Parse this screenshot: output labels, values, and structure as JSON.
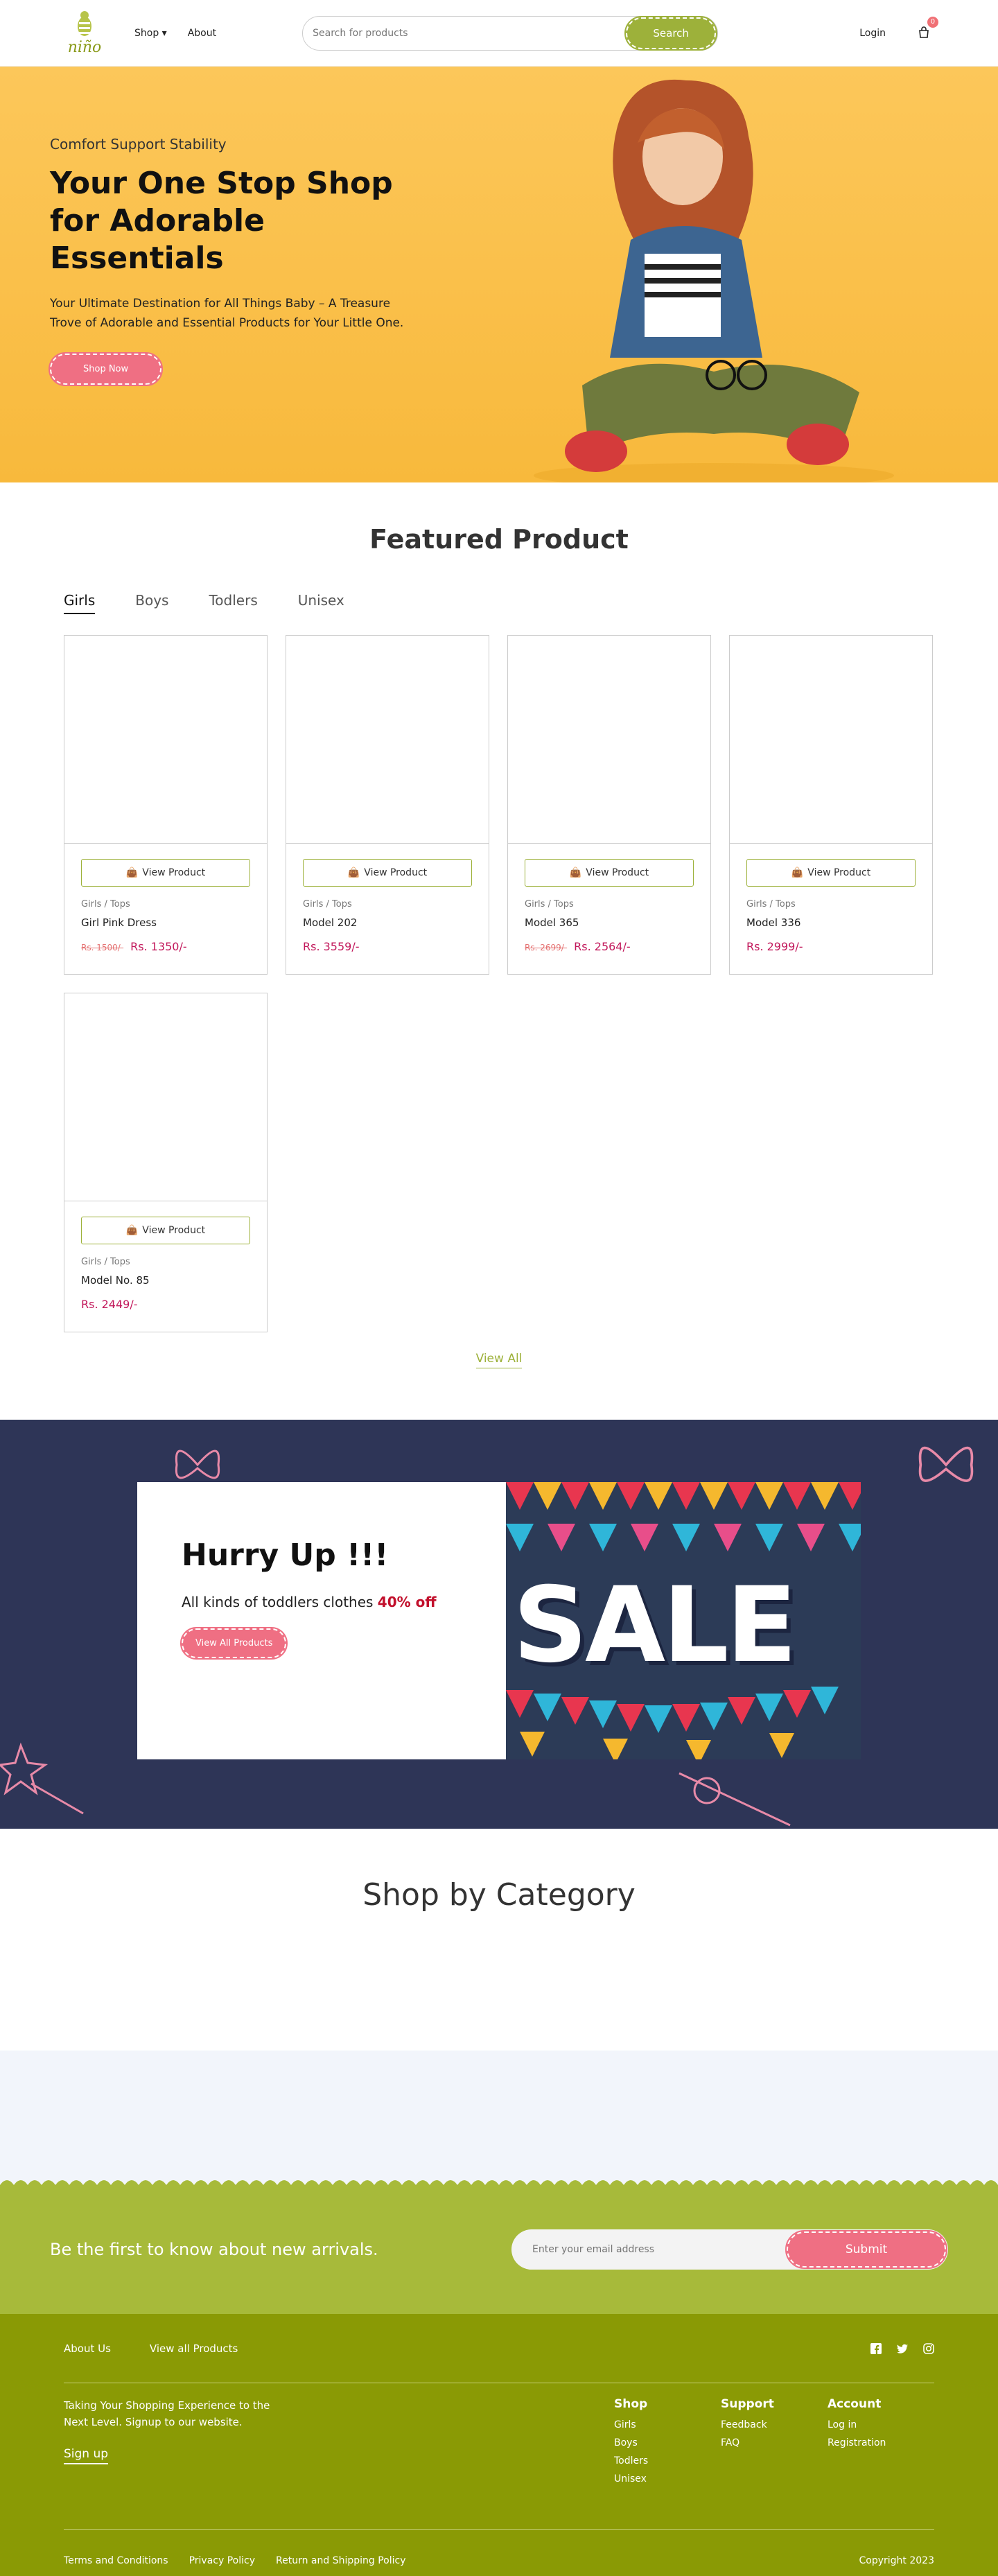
{
  "header": {
    "logo": "niño",
    "nav": [
      "Shop",
      "About"
    ],
    "search_placeholder": "Search for products",
    "search_button": "Search",
    "login": "Login",
    "cart_count": "0"
  },
  "hero": {
    "subtitle": "Comfort Support Stability",
    "title": "Your One Stop Shop for Adorable Essentials",
    "description": "Your Ultimate Destination for All Things Baby – A Treasure Trove of Adorable and Essential Products for Your Little One.",
    "button": "Shop Now"
  },
  "featured": {
    "title": "Featured Product",
    "tabs": [
      "Girls",
      "Boys",
      "Todlers",
      "Unisex"
    ],
    "view_button": "View Product",
    "products": [
      {
        "category": "Girls / Tops",
        "name": "Girl Pink Dress",
        "old_price": "Rs. 1500/-",
        "price": "Rs. 1350/-"
      },
      {
        "category": "Girls / Tops",
        "name": "Model 202",
        "old_price": "",
        "price": "Rs. 3559/-"
      },
      {
        "category": "Girls / Tops",
        "name": "Model 365",
        "old_price": "Rs. 2699/-",
        "price": "Rs. 2564/-"
      },
      {
        "category": "Girls / Tops",
        "name": "Model 336",
        "old_price": "",
        "price": "Rs. 2999/-"
      },
      {
        "category": "Girls / Tops",
        "name": "Model No. 85",
        "old_price": "",
        "price": "Rs. 2449/-"
      }
    ],
    "view_all": "View All"
  },
  "sale": {
    "title": "Hurry Up !!!",
    "line": "All kinds of toddlers clothes",
    "discount": "40% off",
    "button": "View All Products",
    "image_text": "SALE"
  },
  "category": {
    "title": "Shop by Category"
  },
  "newsletter": {
    "text": "Be the first to know about new arrivals.",
    "placeholder": "Enter your email address",
    "button": "Submit"
  },
  "footer": {
    "links": [
      "About Us",
      "View all Products"
    ],
    "tagline": "Taking Your Shopping Experience to the Next Level. Signup to our website.",
    "signup": "Sign up",
    "columns": [
      {
        "title": "Shop",
        "items": [
          "Girls",
          "Boys",
          "Todlers",
          "Unisex"
        ]
      },
      {
        "title": "Support",
        "items": [
          "Feedback",
          "FAQ"
        ]
      },
      {
        "title": "Account",
        "items": [
          "Log in",
          "Registration"
        ]
      }
    ],
    "bottom": [
      "Terms and Conditions",
      "Privacy Policy",
      "Return and Shipping Policy"
    ],
    "copyright": "Copyright 2023"
  }
}
